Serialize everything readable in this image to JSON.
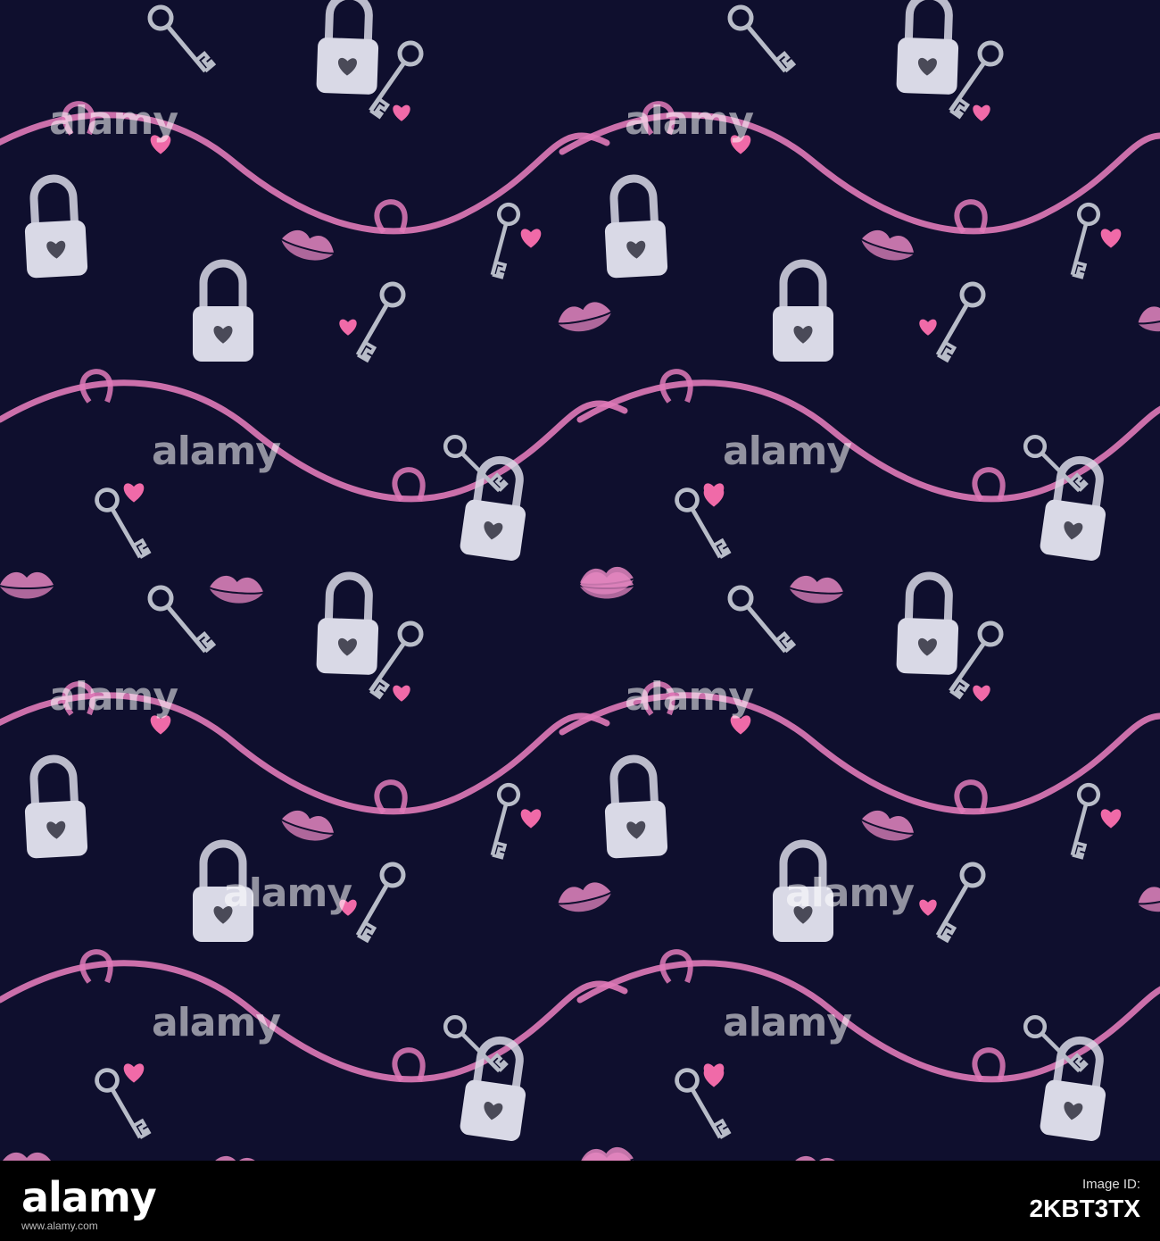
{
  "scene": {
    "background_color": "#0f0f2e",
    "ribbon_color": "#e07ab8",
    "lock_color": "#d9d9e6",
    "key_color": "#b8bcc8",
    "heart_color": "#f06aa8",
    "lips_color": "#e486c0",
    "watermark_text": "alamy"
  },
  "footer": {
    "logo_text": "alamy",
    "image_id_label": "Image ID:",
    "image_id": "2KBT3TX",
    "site": "www.alamy.com"
  }
}
